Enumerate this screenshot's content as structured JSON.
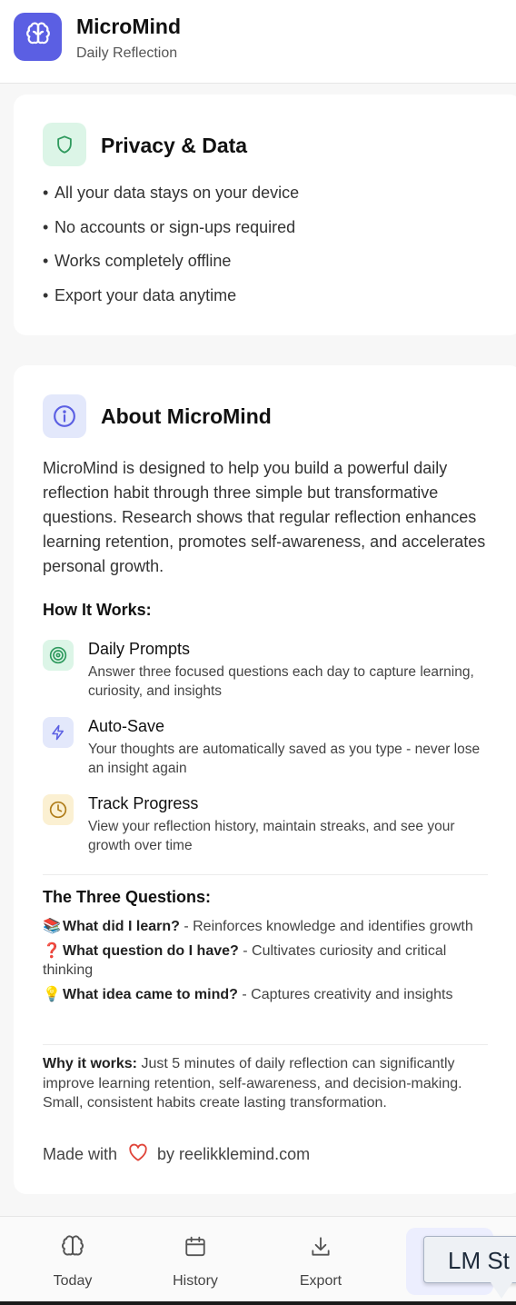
{
  "header": {
    "title": "MicroMind",
    "subtitle": "Daily Reflection",
    "logo_icon": "brain-icon",
    "accent_color": "#5b5fe3"
  },
  "privacy": {
    "title": "Privacy & Data",
    "icon": "shield-icon",
    "items": [
      "All your data stays on your device",
      "No accounts or sign-ups required",
      "Works completely offline",
      "Export your data anytime"
    ]
  },
  "about": {
    "title": "About MicroMind",
    "icon": "info-icon",
    "description": "MicroMind is designed to help you build a powerful daily reflection habit through three simple but transformative questions. Research shows that regular reflection enhances learning retention, promotes self-awareness, and accelerates personal growth.",
    "how_it_works_title": "How It Works:",
    "features": [
      {
        "title": "Daily Prompts",
        "description": "Answer three focused questions each day to capture learning, curiosity, and insights",
        "icon": "target-icon"
      },
      {
        "title": "Auto-Save",
        "description": "Your thoughts are automatically saved as you type - never lose an insight again",
        "icon": "lightning-icon"
      },
      {
        "title": "Track Progress",
        "description": "View your reflection history, maintain streaks, and see your growth over time",
        "icon": "clock-icon"
      }
    ],
    "questions_title": "The Three Questions:",
    "questions": [
      {
        "emoji": "📚",
        "question": "What did I learn?",
        "description": "- Reinforces knowledge and identifies growth"
      },
      {
        "emoji": "❓",
        "question": "What question do I have?",
        "description": "- Cultivates curiosity and critical thinking"
      },
      {
        "emoji": "💡",
        "question": "What idea came to mind?",
        "description": "- Captures creativity and insights"
      }
    ],
    "why_label": "Why it works:",
    "why_text": " Just 5 minutes of daily reflection can significantly improve learning retention, self-awareness, and decision-making. Small, consistent habits create lasting transformation.",
    "made_with": "Made with",
    "made_by": "by reelikklemind.com"
  },
  "nav": {
    "items": [
      {
        "label": "Today",
        "icon": "brain-icon"
      },
      {
        "label": "History",
        "icon": "calendar-icon"
      },
      {
        "label": "Export",
        "icon": "download-icon"
      }
    ]
  },
  "tooltip": {
    "text": "LM St"
  }
}
